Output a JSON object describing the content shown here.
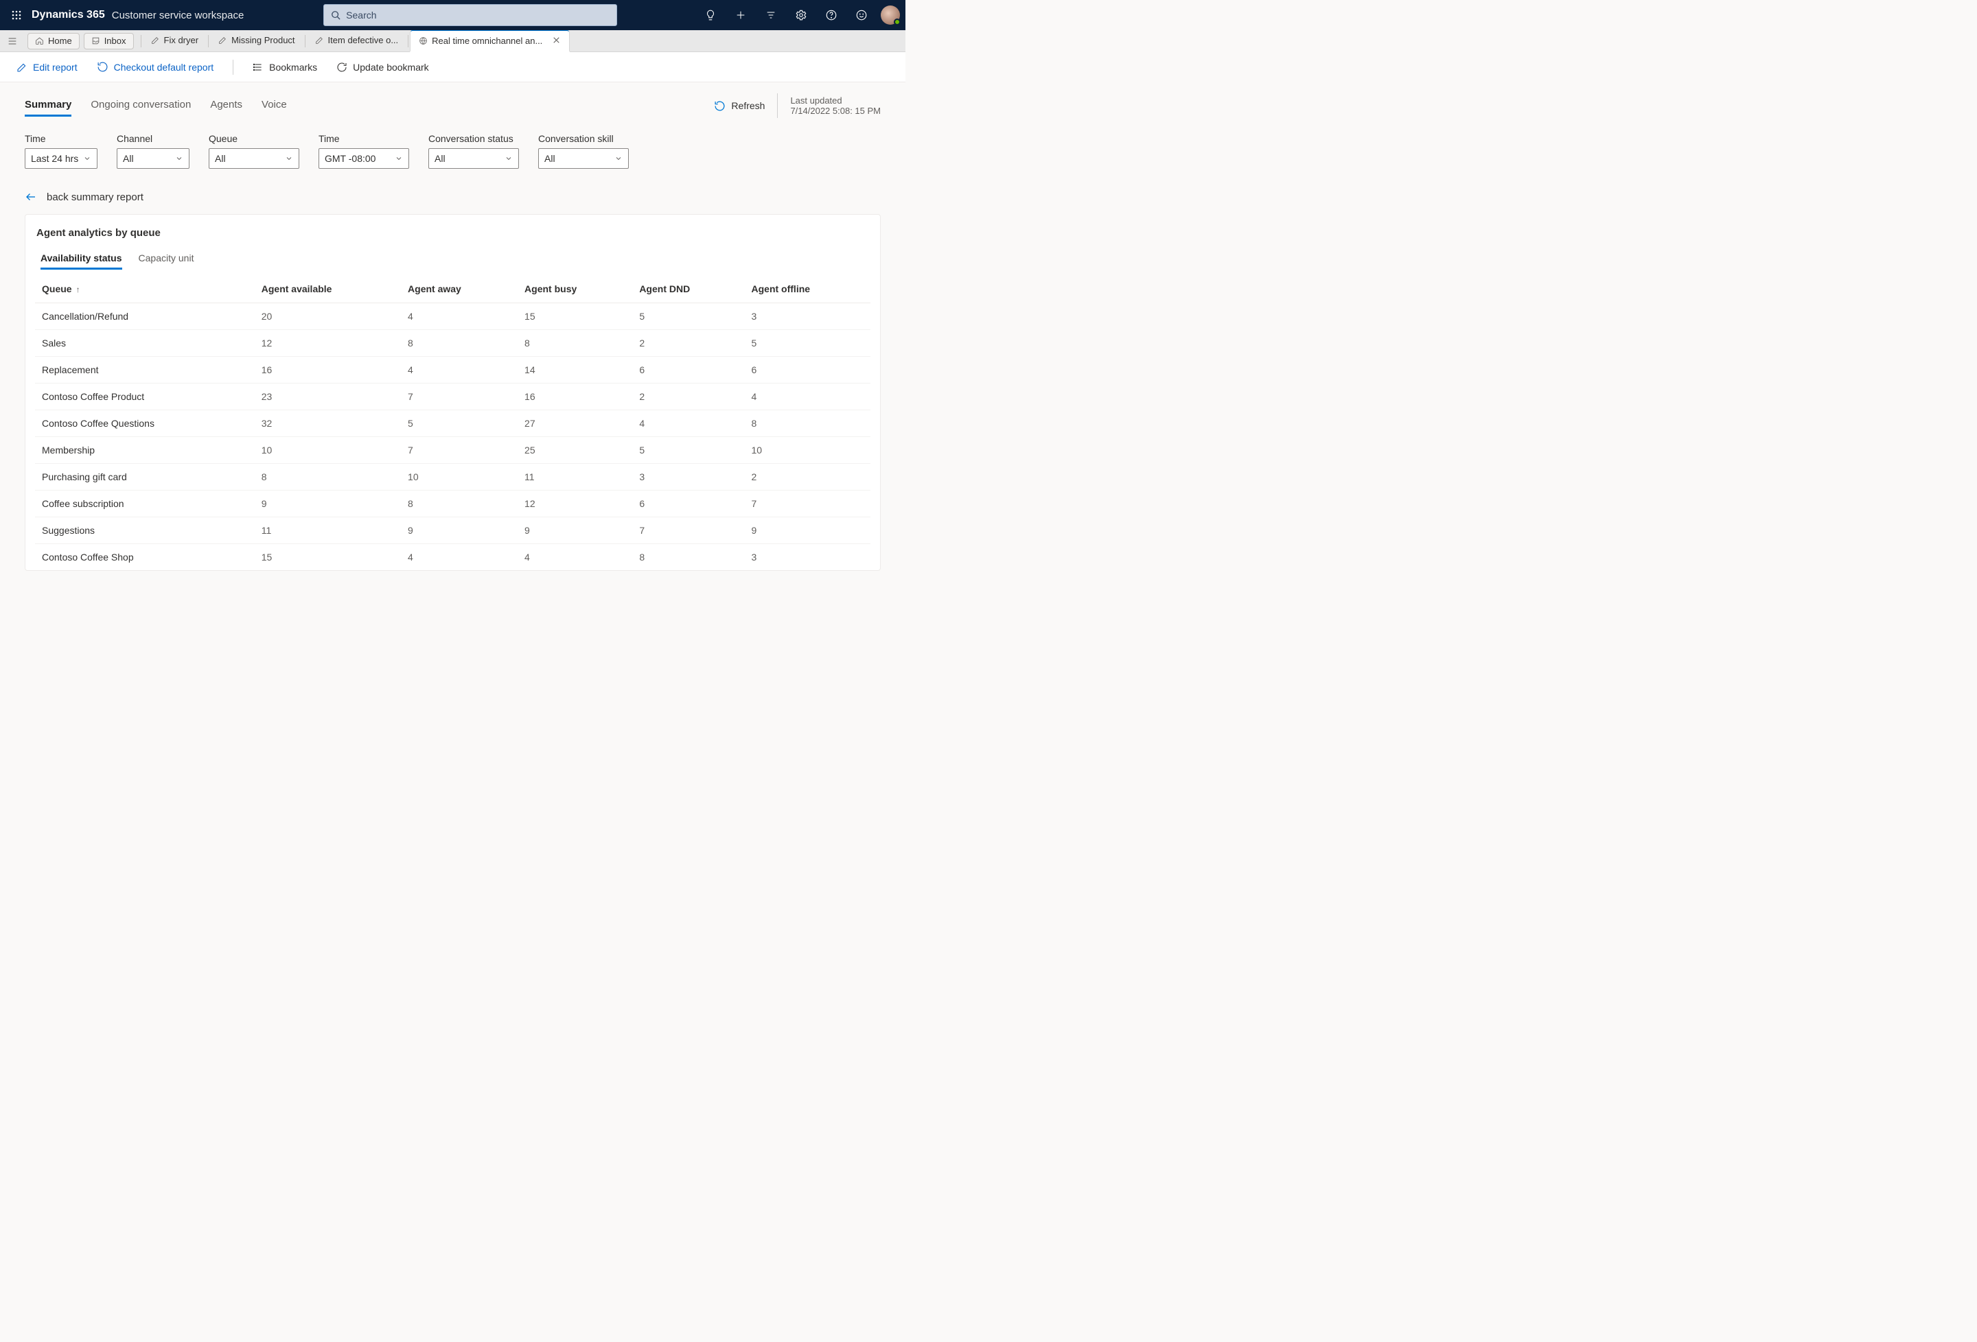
{
  "topnav": {
    "brand": "Dynamics 365",
    "subbrand": "Customer service workspace",
    "search_placeholder": "Search"
  },
  "session": {
    "home": "Home",
    "inbox": "Inbox",
    "tabs": [
      {
        "label": "Fix dryer"
      },
      {
        "label": "Missing Product"
      },
      {
        "label": "Item defective o..."
      },
      {
        "label": "Real time omnichannel an...",
        "active": true
      }
    ]
  },
  "commands": {
    "edit": "Edit report",
    "checkout": "Checkout default report",
    "bookmarks": "Bookmarks",
    "update": "Update bookmark"
  },
  "report_tabs": {
    "items": [
      "Summary",
      "Ongoing conversation",
      "Agents",
      "Voice"
    ],
    "active": "Summary"
  },
  "refresh_label": "Refresh",
  "last_updated": {
    "label": "Last updated",
    "value": "7/14/2022 5:08: 15 PM"
  },
  "filters": {
    "time": {
      "label": "Time",
      "value": "Last 24 hrs"
    },
    "channel": {
      "label": "Channel",
      "value": "All"
    },
    "queue": {
      "label": "Queue",
      "value": "All"
    },
    "tz": {
      "label": "Time",
      "value": "GMT -08:00"
    },
    "status": {
      "label": "Conversation status",
      "value": "All"
    },
    "skill": {
      "label": "Conversation skill",
      "value": "All"
    }
  },
  "backlink": "back summary report",
  "card": {
    "title": "Agent analytics by queue",
    "subtabs": {
      "items": [
        "Availability status",
        "Capacity unit"
      ],
      "active": "Availability status"
    },
    "columns": [
      "Queue",
      "Agent available",
      "Agent away",
      "Agent busy",
      "Agent DND",
      "Agent offline"
    ],
    "rows": [
      {
        "q": "Cancellation/Refund",
        "a": 20,
        "w": 4,
        "b": 15,
        "d": 5,
        "o": 3
      },
      {
        "q": "Sales",
        "a": 12,
        "w": 8,
        "b": 8,
        "d": 2,
        "o": 5
      },
      {
        "q": "Replacement",
        "a": 16,
        "w": 4,
        "b": 14,
        "d": 6,
        "o": 6
      },
      {
        "q": "Contoso Coffee Product",
        "a": 23,
        "w": 7,
        "b": 16,
        "d": 2,
        "o": 4
      },
      {
        "q": "Contoso Coffee Questions",
        "a": 32,
        "w": 5,
        "b": 27,
        "d": 4,
        "o": 8
      },
      {
        "q": "Membership",
        "a": 10,
        "w": 7,
        "b": 25,
        "d": 5,
        "o": 10
      },
      {
        "q": "Purchasing gift card",
        "a": 8,
        "w": 10,
        "b": 11,
        "d": 3,
        "o": 2
      },
      {
        "q": "Coffee subscription",
        "a": 9,
        "w": 8,
        "b": 12,
        "d": 6,
        "o": 7
      },
      {
        "q": "Suggestions",
        "a": 11,
        "w": 9,
        "b": 9,
        "d": 7,
        "o": 9
      },
      {
        "q": "Contoso Coffee Shop",
        "a": 15,
        "w": 4,
        "b": 4,
        "d": 8,
        "o": 3
      }
    ]
  },
  "chart_data": {
    "type": "table",
    "title": "Agent analytics by queue – Availability status",
    "columns": [
      "Queue",
      "Agent available",
      "Agent away",
      "Agent busy",
      "Agent DND",
      "Agent offline"
    ],
    "rows": [
      [
        "Cancellation/Refund",
        20,
        4,
        15,
        5,
        3
      ],
      [
        "Sales",
        12,
        8,
        8,
        2,
        5
      ],
      [
        "Replacement",
        16,
        4,
        14,
        6,
        6
      ],
      [
        "Contoso Coffee Product",
        23,
        7,
        16,
        2,
        4
      ],
      [
        "Contoso Coffee Questions",
        32,
        5,
        27,
        4,
        8
      ],
      [
        "Membership",
        10,
        7,
        25,
        5,
        10
      ],
      [
        "Purchasing gift card",
        8,
        10,
        11,
        3,
        2
      ],
      [
        "Coffee subscription",
        9,
        8,
        12,
        6,
        7
      ],
      [
        "Suggestions",
        11,
        9,
        9,
        7,
        9
      ],
      [
        "Contoso Coffee Shop",
        15,
        4,
        4,
        8,
        3
      ]
    ]
  }
}
